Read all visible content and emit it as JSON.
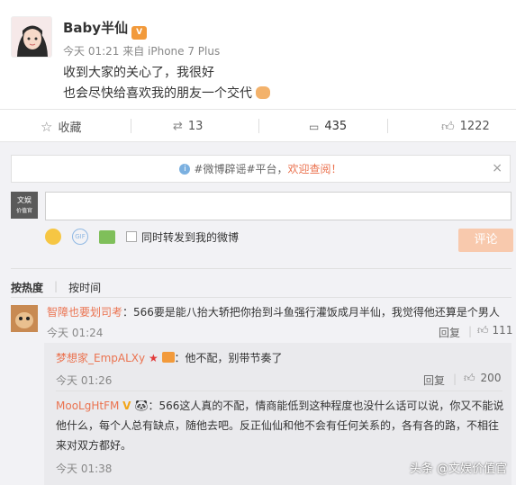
{
  "post": {
    "username": "Baby半仙",
    "badge": "V",
    "meta": "今天 01:21 来自 iPhone 7 Plus",
    "line1": "收到大家的关心了，我很好",
    "line2": "也会尽快给喜欢我的朋友一个交代"
  },
  "actions": {
    "favorite": "收藏",
    "repost_count": "13",
    "comment_count": "435",
    "like_count": "1222"
  },
  "notice": {
    "text": "#微博辟谣#平台，",
    "link": "欢迎查阅！",
    "close": "×"
  },
  "my_avatar": {
    "line1": "文娱",
    "line2": "价值官"
  },
  "compose": {
    "repost_check_label": "同时转发到我的微博",
    "submit_label": "评论"
  },
  "sort": {
    "hot": "按热度",
    "time": "按时间"
  },
  "comments": [
    {
      "name": "智障也要划司考",
      "text": "：566要是能八抬大轿把你抬到斗鱼强行灌饭成月半仙，我觉得他还算是个男人",
      "time": "今天 01:24",
      "reply_label": "回复",
      "likes": "111"
    }
  ],
  "replies": [
    {
      "name": "梦想家_EmpALXy",
      "text": "：他不配，别带节奏了",
      "time": "今天 01:26",
      "reply_label": "回复",
      "likes": "200"
    },
    {
      "name": "MooLgHtFM",
      "text_line1": "：566这人真的不配，情商能低到这种程度也没什么话可以说，你又不能说",
      "text_line2": "他什么，每个人总有缺点，随他去吧。反正仙仙和他不会有任何关系的，各有各的路，不相往",
      "text_line3": "来对双方都好。",
      "time": "今天 01:38"
    }
  ],
  "watermark": "头条 @文娱价值官",
  "colors": {
    "accent": "#eb7350",
    "submit_disabled": "#f8c9ad",
    "comment_bg": "#f2f2f5"
  }
}
